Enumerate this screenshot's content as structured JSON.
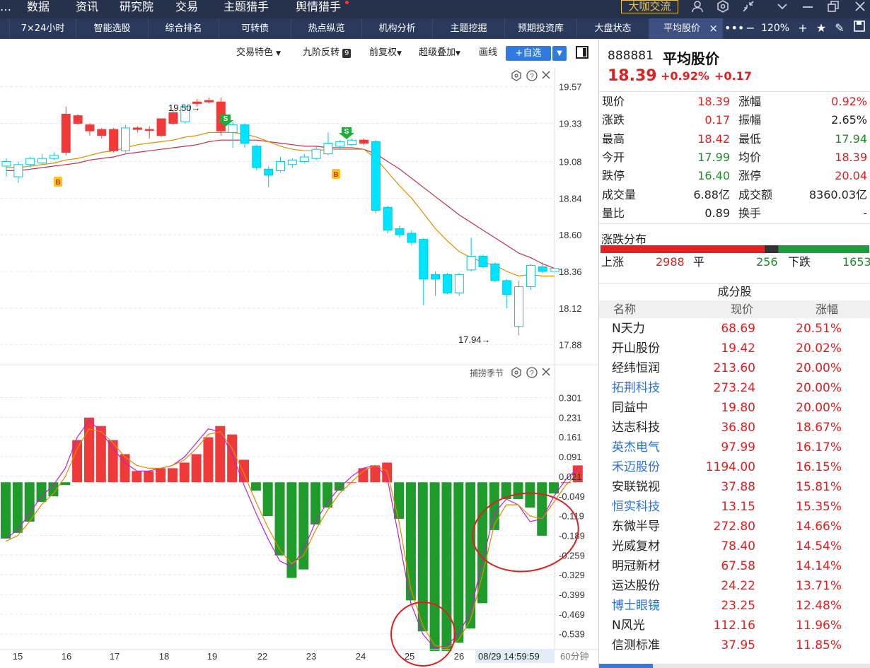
{
  "topbar": {
    "menus": [
      "数据",
      "资讯",
      "研究院",
      "交易",
      "主题猎手",
      "舆情猎手"
    ],
    "forum_button": "大咖交流",
    "icons": [
      "user-icon",
      "settings-hex-icon",
      "shrink-icon",
      "chevron-down-icon",
      "minimize-icon",
      "restore-icon",
      "close-icon"
    ]
  },
  "tabs": [
    "7×24小时",
    "智能选股",
    "综合排名",
    "可转债",
    "热点纵览",
    "机构分析",
    "主题挖掘",
    "预期投资库",
    "大盘状态",
    "平均股价"
  ],
  "active_tab": "平均股价",
  "tab_close": "×",
  "zoom": "120%",
  "toolbar": {
    "trade_feature": "交易特色",
    "nine_reversal": "九阶反转",
    "nine_badge": "9",
    "adjust": "前复权",
    "overlay": "超级叠加",
    "draw": "画线",
    "add_fav": "+自选"
  },
  "indicator_label": "捕捞季节",
  "timestamp": "08/29 14:59:59",
  "period": "60分钟",
  "chart_data": [
    {
      "type": "candlestick",
      "price_axis": [
        19.57,
        19.33,
        19.08,
        18.84,
        18.6,
        18.36,
        18.12,
        17.88
      ],
      "ylim": [
        17.8,
        19.67
      ],
      "x_labels": [
        "15",
        "16",
        "17",
        "18",
        "19",
        "22",
        "23",
        "24",
        "25",
        "26"
      ],
      "candles": [
        {
          "o": 19.05,
          "c": 19.08,
          "h": 19.1,
          "l": 18.98,
          "dir": "down"
        },
        {
          "o": 18.98,
          "c": 19.06,
          "h": 19.08,
          "l": 18.94,
          "dir": "down"
        },
        {
          "o": 19.06,
          "c": 19.1,
          "h": 19.11,
          "l": 19.04,
          "dir": "down"
        },
        {
          "o": 19.07,
          "c": 19.1,
          "h": 19.13,
          "l": 19.06,
          "dir": "down"
        },
        {
          "o": 19.1,
          "c": 19.12,
          "h": 19.14,
          "l": 19.09,
          "dir": "down"
        },
        {
          "o": 19.14,
          "c": 19.39,
          "h": 19.44,
          "l": 19.12,
          "dir": "up"
        },
        {
          "o": 19.38,
          "c": 19.33,
          "h": 19.39,
          "l": 19.32,
          "dir": "up"
        },
        {
          "o": 19.32,
          "c": 19.28,
          "h": 19.33,
          "l": 19.25,
          "dir": "up"
        },
        {
          "o": 19.29,
          "c": 19.25,
          "h": 19.3,
          "l": 19.23,
          "dir": "up"
        },
        {
          "o": 19.29,
          "c": 19.15,
          "h": 19.3,
          "l": 19.14,
          "dir": "up"
        },
        {
          "o": 19.15,
          "c": 19.3,
          "h": 19.32,
          "l": 19.14,
          "dir": "down"
        },
        {
          "o": 19.3,
          "c": 19.29,
          "h": 19.31,
          "l": 19.27,
          "dir": "up"
        },
        {
          "o": 19.29,
          "c": 19.29,
          "h": 19.31,
          "l": 19.23,
          "dir": "up"
        },
        {
          "o": 19.36,
          "c": 19.25,
          "h": 19.36,
          "l": 19.24,
          "dir": "up"
        },
        {
          "o": 19.4,
          "c": 19.33,
          "h": 19.42,
          "l": 19.32,
          "dir": "up"
        },
        {
          "o": 19.34,
          "c": 19.44,
          "h": 19.45,
          "l": 19.33,
          "dir": "down"
        },
        {
          "o": 19.46,
          "c": 19.47,
          "h": 19.49,
          "l": 19.44,
          "dir": "up"
        },
        {
          "o": 19.47,
          "c": 19.48,
          "h": 19.5,
          "l": 19.46,
          "dir": "up"
        },
        {
          "o": 19.47,
          "c": 19.28,
          "h": 19.5,
          "l": 19.25,
          "dir": "up"
        },
        {
          "o": 19.27,
          "c": 19.32,
          "h": 19.34,
          "l": 19.17,
          "dir": "down"
        },
        {
          "o": 19.32,
          "c": 19.2,
          "h": 19.33,
          "l": 19.17,
          "dir": "down"
        },
        {
          "o": 19.18,
          "c": 19.04,
          "h": 19.19,
          "l": 19.02,
          "dir": "down"
        },
        {
          "o": 19.03,
          "c": 18.99,
          "h": 19.05,
          "l": 18.91,
          "dir": "down"
        },
        {
          "o": 19.02,
          "c": 19.08,
          "h": 19.11,
          "l": 19.01,
          "dir": "down"
        },
        {
          "o": 19.06,
          "c": 19.09,
          "h": 19.1,
          "l": 19.04,
          "dir": "down"
        },
        {
          "o": 19.08,
          "c": 19.11,
          "h": 19.13,
          "l": 19.07,
          "dir": "down"
        },
        {
          "o": 19.1,
          "c": 19.16,
          "h": 19.18,
          "l": 19.09,
          "dir": "down"
        },
        {
          "o": 19.13,
          "c": 19.2,
          "h": 19.27,
          "l": 19.12,
          "dir": "down"
        },
        {
          "o": 19.18,
          "c": 19.21,
          "h": 19.22,
          "l": 19.16,
          "dir": "down"
        },
        {
          "o": 19.19,
          "c": 19.22,
          "h": 19.23,
          "l": 19.18,
          "dir": "down"
        },
        {
          "o": 19.22,
          "c": 19.2,
          "h": 19.23,
          "l": 19.19,
          "dir": "up"
        },
        {
          "o": 19.21,
          "c": 18.76,
          "h": 19.22,
          "l": 18.74,
          "dir": "down"
        },
        {
          "o": 18.78,
          "c": 18.63,
          "h": 18.79,
          "l": 18.61,
          "dir": "down"
        },
        {
          "o": 18.64,
          "c": 18.6,
          "h": 18.66,
          "l": 18.58,
          "dir": "down"
        },
        {
          "o": 18.61,
          "c": 18.55,
          "h": 18.63,
          "l": 18.53,
          "dir": "down"
        },
        {
          "o": 18.57,
          "c": 18.31,
          "h": 18.58,
          "l": 18.14,
          "dir": "down"
        },
        {
          "o": 18.34,
          "c": 18.31,
          "h": 18.36,
          "l": 18.2,
          "dir": "down"
        },
        {
          "o": 18.34,
          "c": 18.22,
          "h": 18.35,
          "l": 18.21,
          "dir": "down"
        },
        {
          "o": 18.22,
          "c": 18.34,
          "h": 18.35,
          "l": 18.2,
          "dir": "down"
        },
        {
          "o": 18.37,
          "c": 18.46,
          "h": 18.58,
          "l": 18.36,
          "dir": "down"
        },
        {
          "o": 18.46,
          "c": 18.39,
          "h": 18.47,
          "l": 18.38,
          "dir": "down"
        },
        {
          "o": 18.41,
          "c": 18.3,
          "h": 18.42,
          "l": 18.29,
          "dir": "down"
        },
        {
          "o": 18.3,
          "c": 18.21,
          "h": 18.31,
          "l": 18.12,
          "dir": "down"
        },
        {
          "o": 18.0,
          "c": 18.26,
          "h": 18.3,
          "l": 17.94,
          "dir": "down"
        },
        {
          "o": 18.26,
          "c": 18.4,
          "h": 18.41,
          "l": 18.24,
          "dir": "down"
        },
        {
          "o": 18.39,
          "c": 18.36,
          "h": 18.42,
          "l": 18.35,
          "dir": "down"
        },
        {
          "o": 18.36,
          "c": 18.38,
          "h": 18.4,
          "l": 18.34,
          "dir": "down"
        }
      ],
      "ma_short": [
        19.04,
        19.04,
        19.05,
        19.06,
        19.07,
        19.09,
        19.1,
        19.12,
        19.14,
        19.15,
        19.17,
        19.19,
        19.2,
        19.21,
        19.22,
        19.24,
        19.25,
        19.27,
        19.27,
        19.27,
        19.26,
        19.24,
        19.21,
        19.18,
        19.16,
        19.15,
        19.15,
        19.16,
        19.16,
        19.16,
        19.16,
        19.1,
        19.01,
        18.92,
        18.84,
        18.74,
        18.64,
        18.56,
        18.49,
        18.45,
        18.42,
        18.4,
        18.36,
        18.33,
        18.34,
        18.33,
        18.33
      ],
      "ma_long": [
        19.02,
        19.02,
        19.03,
        19.04,
        19.05,
        19.06,
        19.07,
        19.09,
        19.1,
        19.11,
        19.13,
        19.14,
        19.15,
        19.16,
        19.17,
        19.18,
        19.19,
        19.21,
        19.22,
        19.22,
        19.22,
        19.22,
        19.21,
        19.2,
        19.19,
        19.18,
        19.18,
        19.17,
        19.17,
        19.17,
        19.16,
        19.13,
        19.08,
        19.03,
        18.97,
        18.91,
        18.85,
        18.79,
        18.73,
        18.68,
        18.63,
        18.58,
        18.53,
        18.48,
        18.45,
        18.41,
        18.38
      ],
      "annotations": {
        "high_label": "19.50",
        "low_label": "17.94",
        "buy_marker": "B",
        "sell_marker": "S"
      }
    },
    {
      "type": "bar",
      "name": "捕捞季节",
      "y_axis": [
        0.301,
        0.231,
        0.161,
        0.091,
        0.021,
        -0.049,
        -0.119,
        -0.189,
        -0.259,
        -0.329,
        -0.399,
        -0.469,
        -0.539
      ],
      "ylim": [
        -0.59,
        0.35
      ],
      "values": [
        -0.2,
        -0.18,
        -0.14,
        -0.07,
        -0.05,
        -0.01,
        0.15,
        0.23,
        0.2,
        0.15,
        0.1,
        0.04,
        0.04,
        0.05,
        0.05,
        0.07,
        0.1,
        0.16,
        0.2,
        0.17,
        0.08,
        -0.03,
        -0.12,
        -0.26,
        -0.34,
        -0.31,
        -0.15,
        -0.09,
        -0.03,
        0.0,
        0.05,
        0.06,
        0.07,
        -0.13,
        -0.42,
        -0.53,
        -0.6,
        -0.6,
        -0.57,
        -0.52,
        -0.43,
        -0.17,
        -0.06,
        -0.06,
        -0.09,
        -0.19,
        -0.04,
        0.0,
        0.06
      ],
      "line_a": [
        -0.2,
        -0.17,
        -0.11,
        -0.05,
        -0.01,
        0.05,
        0.16,
        0.22,
        0.18,
        0.12,
        0.07,
        0.04,
        0.04,
        0.05,
        0.06,
        0.09,
        0.14,
        0.19,
        0.18,
        0.1,
        -0.01,
        -0.11,
        -0.2,
        -0.28,
        -0.3,
        -0.24,
        -0.14,
        -0.07,
        -0.02,
        0.02,
        0.05,
        0.06,
        0.02,
        -0.2,
        -0.43,
        -0.54,
        -0.59,
        -0.58,
        -0.54,
        -0.46,
        -0.28,
        -0.11,
        -0.06,
        -0.08,
        -0.14,
        -0.13,
        -0.05,
        0.01,
        0.05
      ],
      "line_b": [
        -0.21,
        -0.19,
        -0.14,
        -0.08,
        -0.04,
        0.02,
        0.12,
        0.19,
        0.18,
        0.14,
        0.09,
        0.06,
        0.05,
        0.05,
        0.06,
        0.08,
        0.12,
        0.17,
        0.18,
        0.12,
        0.03,
        -0.07,
        -0.16,
        -0.24,
        -0.29,
        -0.26,
        -0.17,
        -0.1,
        -0.04,
        0.0,
        0.04,
        0.06,
        0.04,
        -0.14,
        -0.38,
        -0.51,
        -0.58,
        -0.59,
        -0.56,
        -0.49,
        -0.33,
        -0.15,
        -0.08,
        -0.08,
        -0.12,
        -0.13,
        -0.07,
        -0.01,
        0.03
      ]
    }
  ],
  "side": {
    "code": "888881",
    "name": "平均股价",
    "price": "18.39",
    "pct": "+0.92%",
    "chg": "+0.17",
    "quote": {
      "left": [
        [
          "现价",
          "18.39",
          "red"
        ],
        [
          "涨跌",
          "0.17",
          "red"
        ],
        [
          "最高",
          "18.42",
          "red"
        ],
        [
          "今开",
          "17.99",
          "green"
        ],
        [
          "跌停",
          "16.40",
          "green"
        ],
        [
          "成交量",
          "6.88亿",
          "black"
        ],
        [
          "量比",
          "0.89",
          "black"
        ]
      ],
      "right": [
        [
          "涨幅",
          "0.92%",
          "red"
        ],
        [
          "振幅",
          "2.65%",
          "black"
        ],
        [
          "最低",
          "17.94",
          "green"
        ],
        [
          "均价",
          "18.39",
          "red"
        ],
        [
          "涨停",
          "20.04",
          "red"
        ],
        [
          "成交额",
          "8360.03亿",
          "black"
        ],
        [
          "换手",
          "-",
          "black"
        ]
      ]
    },
    "dist_title": "涨跌分布",
    "dist": {
      "up_label": "上涨",
      "up": "2988",
      "flat_label": "平",
      "flat": "256",
      "down_label": "下跌",
      "down": "1653",
      "up_n": 2988,
      "flat_n": 256,
      "down_n": 1653
    },
    "components_title": "成分股",
    "comp_headers": [
      "名称",
      "现价",
      "涨幅"
    ],
    "components": [
      {
        "name": "N天力",
        "price": "68.69",
        "pct": "20.51%",
        "blue": false
      },
      {
        "name": "开山股份",
        "price": "19.42",
        "pct": "20.02%",
        "blue": false
      },
      {
        "name": "经纬恒润",
        "price": "213.60",
        "pct": "20.00%",
        "blue": false
      },
      {
        "name": "拓荆科技",
        "price": "273.24",
        "pct": "20.00%",
        "blue": true
      },
      {
        "name": "同益中",
        "price": "19.80",
        "pct": "20.00%",
        "blue": false
      },
      {
        "name": "达志科技",
        "price": "36.80",
        "pct": "18.67%",
        "blue": false
      },
      {
        "name": "英杰电气",
        "price": "97.99",
        "pct": "16.17%",
        "blue": true
      },
      {
        "name": "禾迈股份",
        "price": "1194.00",
        "pct": "16.15%",
        "blue": true
      },
      {
        "name": "安联锐视",
        "price": "37.88",
        "pct": "15.81%",
        "blue": false
      },
      {
        "name": "恒实科技",
        "price": "13.15",
        "pct": "15.35%",
        "blue": true
      },
      {
        "name": "东微半导",
        "price": "272.80",
        "pct": "14.66%",
        "blue": false
      },
      {
        "name": "光威复材",
        "price": "78.40",
        "pct": "14.54%",
        "blue": false
      },
      {
        "name": "明冠新材",
        "price": "67.58",
        "pct": "14.14%",
        "blue": false
      },
      {
        "name": "运达股份",
        "price": "24.22",
        "pct": "13.71%",
        "blue": false
      },
      {
        "name": "博士眼镜",
        "price": "23.25",
        "pct": "12.48%",
        "blue": true
      },
      {
        "name": "N风光",
        "price": "112.16",
        "pct": "11.96%",
        "blue": false
      },
      {
        "name": "信测标准",
        "price": "37.95",
        "pct": "11.85%",
        "blue": false
      }
    ]
  },
  "colors": {
    "up": "#f03a3a",
    "down_candle": "#00e5ff",
    "down_bar": "#1e9b2a",
    "ma_short": "#e08c00",
    "ma_long": "#c0304a",
    "line_a": "#c020d0",
    "line_b": "#e08c00",
    "highlight": "#e02020"
  }
}
